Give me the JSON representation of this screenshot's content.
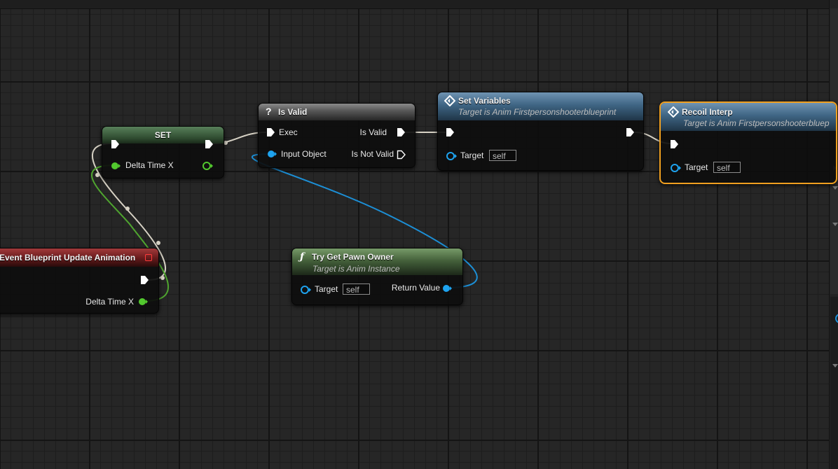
{
  "window": {
    "title": ""
  },
  "nodes": {
    "set": {
      "title": "SET",
      "input_label": "Delta Time X"
    },
    "is_valid": {
      "icon_text": "?",
      "title": "Is Valid",
      "exec_in_label": "Exec",
      "input_object_label": "Input Object",
      "is_valid_label": "Is Valid",
      "is_not_valid_label": "Is Not Valid"
    },
    "set_variables": {
      "title": "Set Variables",
      "subtitle": "Target is Anim Firstpersonshooterblueprint",
      "target_label": "Target",
      "target_value": "self"
    },
    "recoil_interp": {
      "title": "Recoil Interp",
      "subtitle": "Target is Anim Firstpersonshooterbluep",
      "target_label": "Target",
      "target_value": "self"
    },
    "event_update": {
      "title": "Event Blueprint Update Animation",
      "output_label": "Delta Time X"
    },
    "try_get_pawn": {
      "icon_text": "ƒ",
      "title": "Try Get Pawn Owner",
      "subtitle": "Target is Anim Instance",
      "target_label": "Target",
      "target_value": "self",
      "return_label": "Return Value"
    }
  },
  "icons": {
    "function": "function-icon",
    "branch": "question-icon",
    "set_variables": "diamond-icon",
    "recoil": "diamond-icon",
    "event_delegate": "delegate-pin-icon"
  },
  "colors": {
    "graph_bg": "#262626",
    "exec_wire": "#d6d1c4",
    "float_wire": "#4fa52f",
    "object_wire": "#1c8fd6",
    "float_pin": "#52c92e",
    "object_pin": "#1ea3ef",
    "event_header": "#7a1d1e",
    "function_header": "#3e5a32",
    "variable_header": "#3b5870",
    "set_header": "#3b5e3b",
    "selection_outline": "#f0a020"
  }
}
